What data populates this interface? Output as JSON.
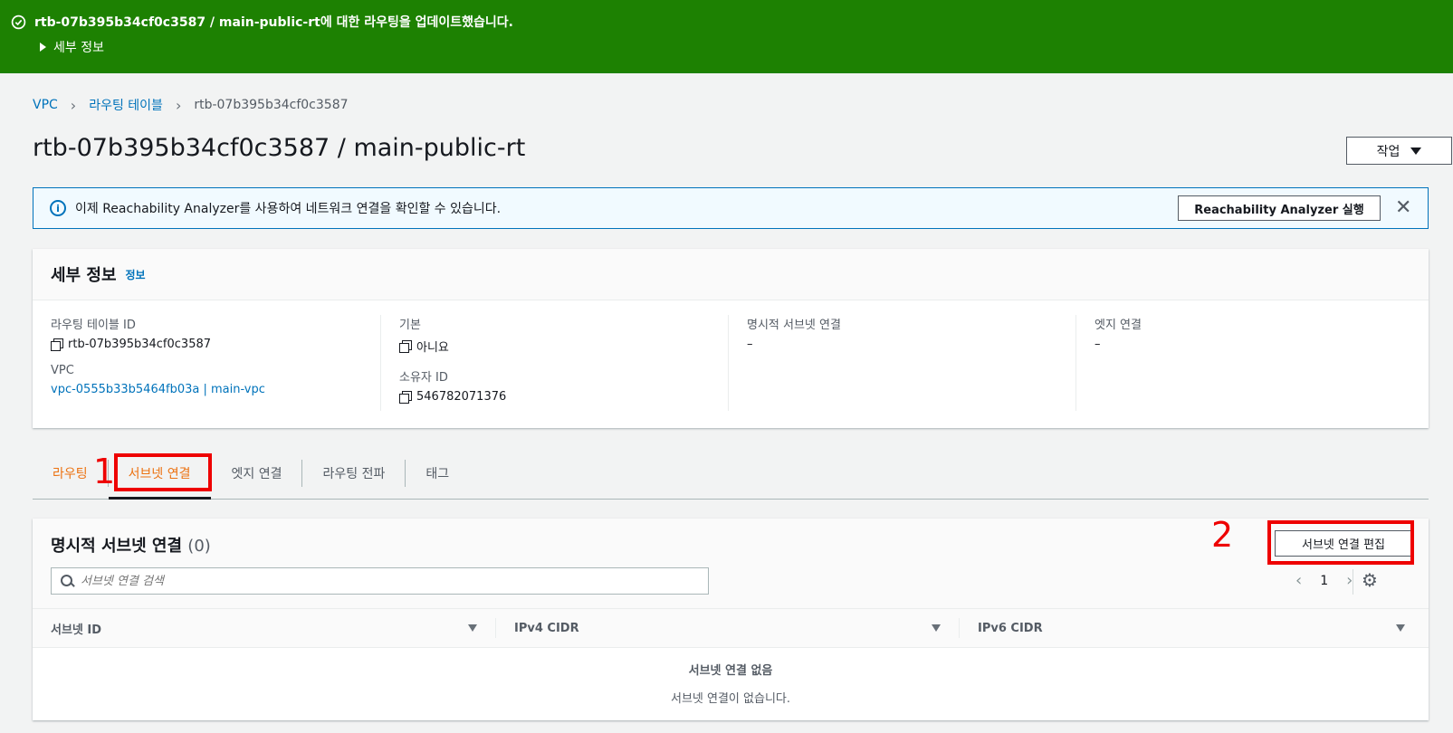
{
  "flash": {
    "message": "rtb-07b395b34cf0c3587 / main-public-rt에 대한 라우팅을 업데이트했습니다.",
    "details_label": "세부 정보"
  },
  "breadcrumb": {
    "items": [
      "VPC",
      "라우팅 테이블",
      "rtb-07b395b34cf0c3587"
    ]
  },
  "page_title": "rtb-07b395b34cf0c3587 / main-public-rt",
  "actions_label": "작업",
  "info_alert": {
    "text": "이제 Reachability Analyzer를 사용하여 네트워크 연결을 확인할 수 있습니다.",
    "button": "Reachability Analyzer 실행"
  },
  "details": {
    "title": "세부 정보",
    "info_link": "정보",
    "fields": {
      "rt_id_label": "라우팅 테이블 ID",
      "rt_id": "rtb-07b395b34cf0c3587",
      "vpc_label": "VPC",
      "vpc": "vpc-0555b33b5464fb03a | main-vpc",
      "main_label": "기본",
      "main": "아니요",
      "owner_label": "소유자 ID",
      "owner": "546782071376",
      "explicit_label": "명시적 서브넷 연결",
      "explicit": "–",
      "edge_label": "엣지 연결",
      "edge": "–"
    }
  },
  "tabs": [
    "라우팅",
    "서브넷 연결",
    "엣지 연결",
    "라우팅 전파",
    "태그"
  ],
  "annotations": {
    "one": "1",
    "two": "2"
  },
  "subnet_panel": {
    "title": "명시적 서브넷 연결",
    "count": "(0)",
    "edit_button": "서브넷 연결 편집",
    "search_placeholder": "서브넷 연결 검색",
    "page": "1",
    "columns": [
      "서브넷 ID",
      "IPv4 CIDR",
      "IPv6 CIDR"
    ],
    "empty_title": "서브넷 연결 없음",
    "empty_text": "서브넷 연결이 없습니다."
  }
}
